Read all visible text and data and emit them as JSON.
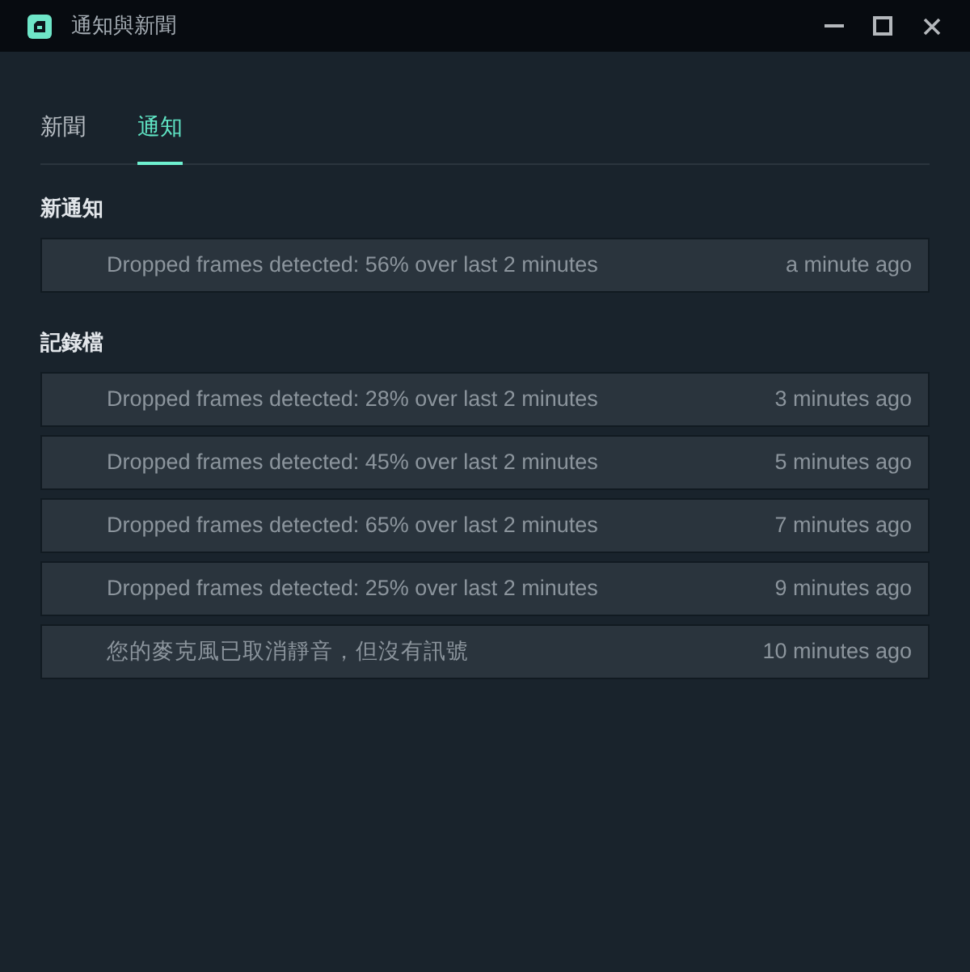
{
  "window": {
    "title": "通知與新聞"
  },
  "tabs": [
    {
      "label": "新聞",
      "selected": false
    },
    {
      "label": "通知",
      "selected": true
    }
  ],
  "sections": [
    {
      "heading": "新通知",
      "items": [
        {
          "message": "Dropped frames detected: 56% over last 2 minutes",
          "time": "a minute ago"
        }
      ]
    },
    {
      "heading": "記錄檔",
      "items": [
        {
          "message": "Dropped frames detected: 28% over last 2 minutes",
          "time": "3 minutes ago"
        },
        {
          "message": "Dropped frames detected: 45% over last 2 minutes",
          "time": "5 minutes ago"
        },
        {
          "message": "Dropped frames detected: 65% over last 2 minutes",
          "time": "7 minutes ago"
        },
        {
          "message": "Dropped frames detected: 25% over last 2 minutes",
          "time": "9 minutes ago"
        },
        {
          "message": "您的麥克風已取消靜音，但沒有訊號",
          "time": "10 minutes ago"
        }
      ]
    }
  ]
}
